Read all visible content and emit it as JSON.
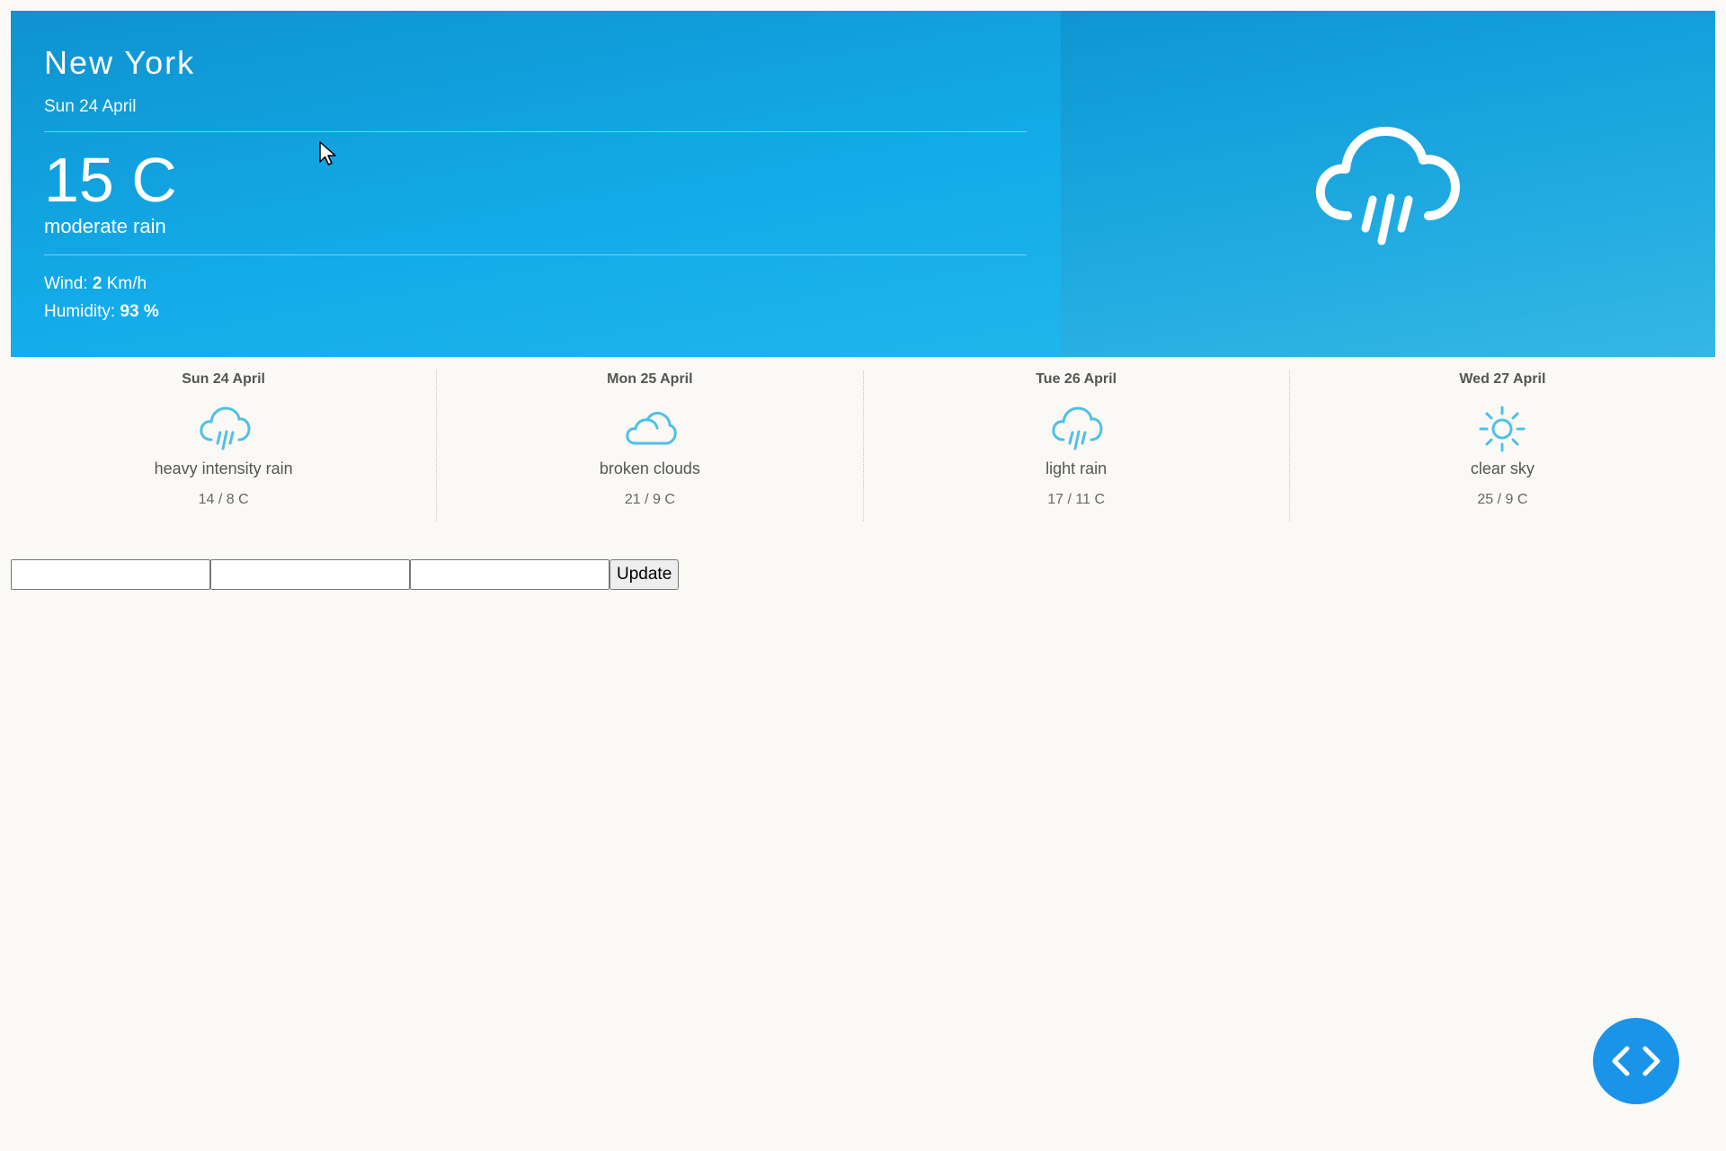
{
  "current": {
    "city": "New York",
    "date": "Sun 24 April",
    "temperature": "15 C",
    "condition": "moderate rain",
    "wind_label": "Wind: ",
    "wind_value": "2",
    "wind_unit": " Km/h",
    "humidity_label": "Humidity: ",
    "humidity_value": "93 %",
    "icon": "rain-cloud-icon"
  },
  "forecast": [
    {
      "day": "Sun 24 April",
      "icon": "rain-cloud-icon",
      "desc": "heavy intensity rain",
      "temps": "14 / 8 C"
    },
    {
      "day": "Mon 25 April",
      "icon": "clouds-icon",
      "desc": "broken clouds",
      "temps": "21 / 9 C"
    },
    {
      "day": "Tue 26 April",
      "icon": "rain-cloud-icon",
      "desc": "light rain",
      "temps": "17 / 11 C"
    },
    {
      "day": "Wed 27 April",
      "icon": "sun-icon",
      "desc": "clear sky",
      "temps": "25 / 9 C"
    }
  ],
  "controls": {
    "input1_value": "",
    "input2_value": "",
    "input3_value": "",
    "update_label": "Update"
  },
  "fab": {
    "icon": "code-icon"
  },
  "colors": {
    "accent": "#13acea",
    "icon_blue": "#4ec0e8",
    "fab": "#1a94e8"
  }
}
